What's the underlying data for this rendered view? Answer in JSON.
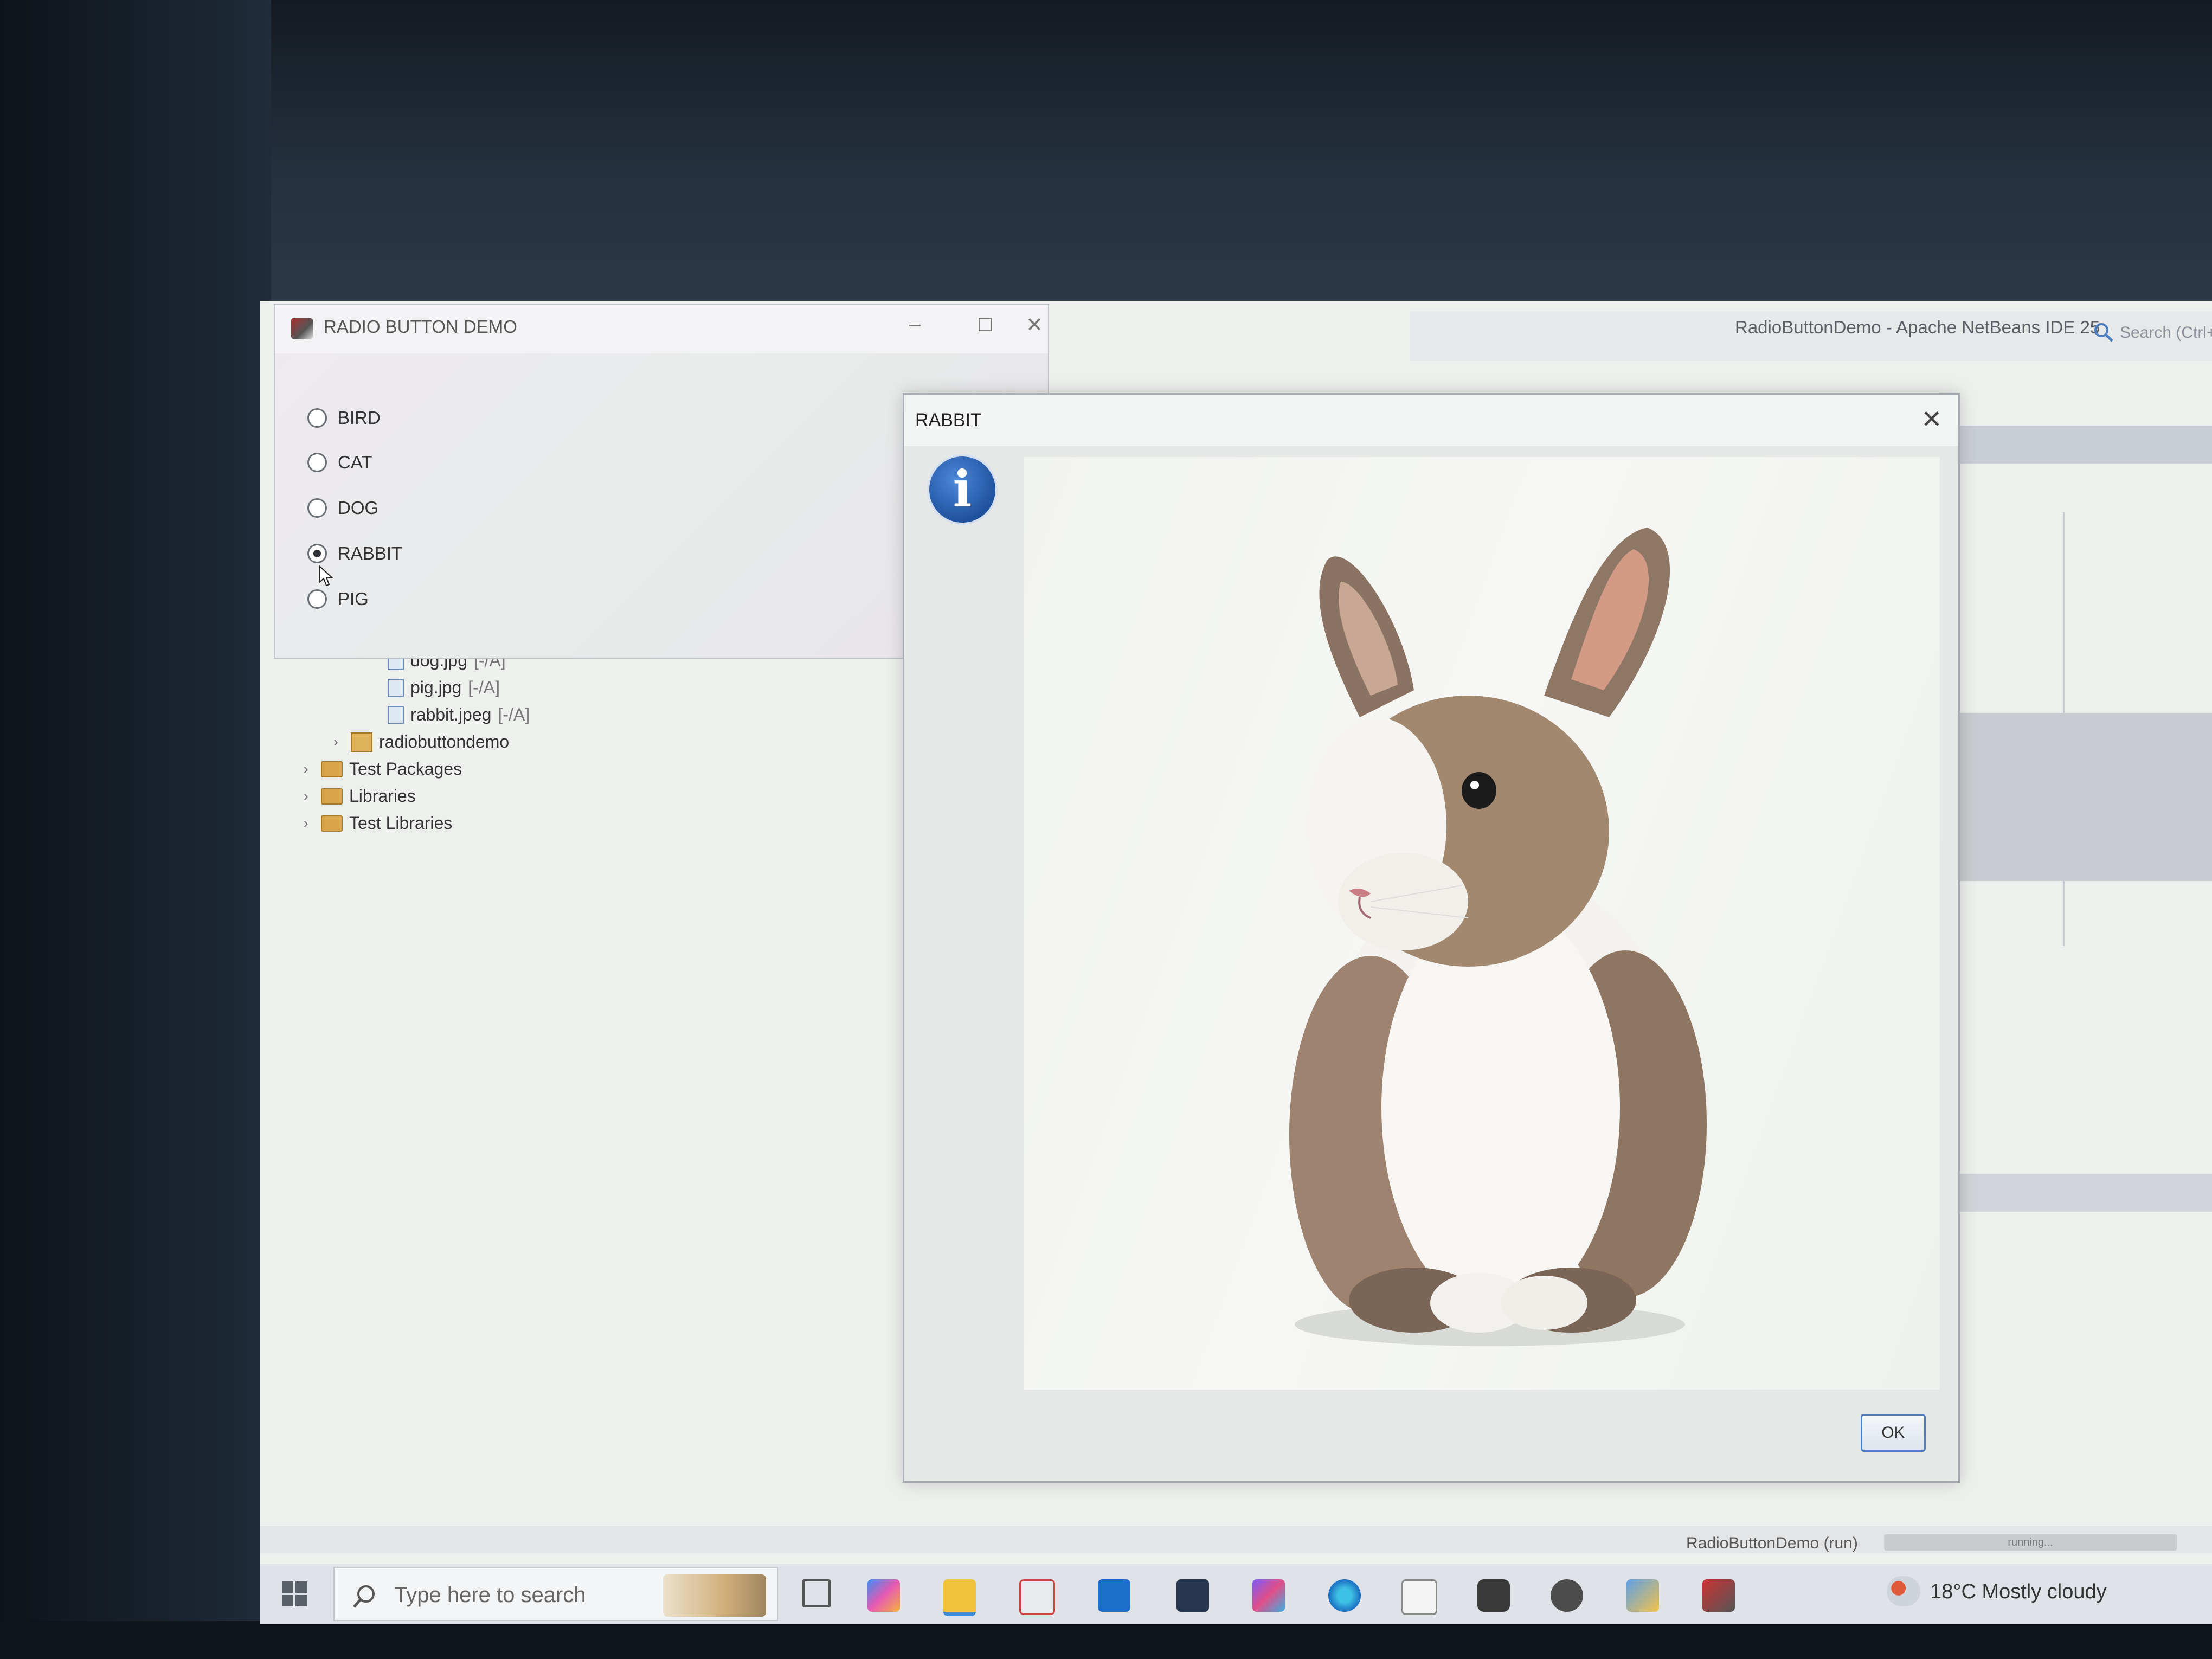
{
  "radio_demo_window": {
    "title": "RADIO BUTTON DEMO",
    "options": [
      {
        "label": "BIRD",
        "selected": false
      },
      {
        "label": "CAT",
        "selected": false
      },
      {
        "label": "DOG",
        "selected": false
      },
      {
        "label": "RABBIT",
        "selected": true
      },
      {
        "label": "PIG",
        "selected": false
      }
    ]
  },
  "netbeans": {
    "title": "RadioButtonDemo - Apache NetBeans IDE 25",
    "search_placeholder": "Search (Ctrl+I)",
    "tree": {
      "files": [
        {
          "name": "dog.jpg",
          "status": "[-/A]"
        },
        {
          "name": "pig.jpg",
          "status": "[-/A]"
        },
        {
          "name": "rabbit.jpeg",
          "status": "[-/A]"
        }
      ],
      "package": "radiobuttondemo",
      "folders": [
        "Test Packages",
        "Libraries",
        "Test Libraries"
      ]
    },
    "status_run": "RadioButtonDemo (run)",
    "status_progress": "running..."
  },
  "dialog": {
    "title": "RABBIT",
    "ok_label": "OK",
    "info_glyph": "i"
  },
  "taskbar": {
    "search_placeholder": "Type here to search",
    "weather": "18°C  Mostly cloudy",
    "icons": [
      "task-view-icon",
      "copilot-icon",
      "file-explorer-icon",
      "microsoft-store-icon",
      "outlook-icon",
      "hi-app-icon",
      "microsoft-365-icon",
      "edge-icon",
      "word-icon",
      "youtube-icon",
      "github-icon",
      "app-icon",
      "netbeans-icon"
    ]
  },
  "colors": {
    "accent_blue": "#1c4f9c",
    "ok_border": "#4a7ec0",
    "taskbar": "#dfe3e8"
  }
}
